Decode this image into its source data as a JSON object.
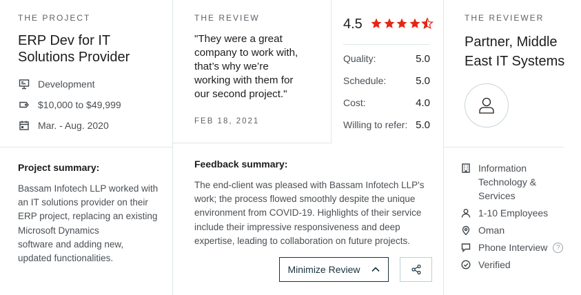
{
  "project": {
    "eyebrow": "THE PROJECT",
    "title_line1": "ERP Dev for IT",
    "title_line2": "Solutions Provider",
    "service": "Development",
    "budget": "$10,000 to $49,999",
    "dates": "Mar. - Aug. 2020",
    "summary_heading": "Project summary:",
    "summary_lines": [
      "Bassam Infotech LLP worked with",
      "an IT solutions provider on their",
      "ERP project, replacing an existing",
      "Microsoft Dynamics",
      "software and adding new,",
      "updated functionalities."
    ]
  },
  "review": {
    "eyebrow": "THE REVIEW",
    "quote_lines": [
      "\"They were a great",
      "company to work with,",
      "that’s why we’re",
      "working with them for",
      "our second project.\""
    ],
    "date": "FEB 18, 2021",
    "feedback_heading": "Feedback summary:",
    "feedback_lines": [
      "The end-client was pleased with Bassam Infotech LLP's",
      "work; the process flowed smoothly despite the unique",
      "environment from COVID-19. Highlights of their service",
      "include their impressive responsiveness and deep",
      "expertise, leading to collaboration on future projects."
    ],
    "minimize_label": "Minimize Review"
  },
  "rating": {
    "overall": "4.5",
    "stars_value": 4.5,
    "star_color": "#e62415",
    "scores": [
      {
        "label": "Quality:",
        "value": "5.0"
      },
      {
        "label": "Schedule:",
        "value": "5.0"
      },
      {
        "label": "Cost:",
        "value": "4.0"
      },
      {
        "label": "Willing to refer:",
        "value": "5.0"
      }
    ]
  },
  "reviewer": {
    "eyebrow": "THE REVIEWER",
    "title_line1": "Partner, Middle",
    "title_line2": "East IT Systems",
    "industry_line1": "Information",
    "industry_line2": "Technology &",
    "industry_line3": "Services",
    "employees": "1-10 Employees",
    "location": "Oman",
    "interview": "Phone Interview",
    "help_glyph": "?",
    "verified": "Verified"
  }
}
